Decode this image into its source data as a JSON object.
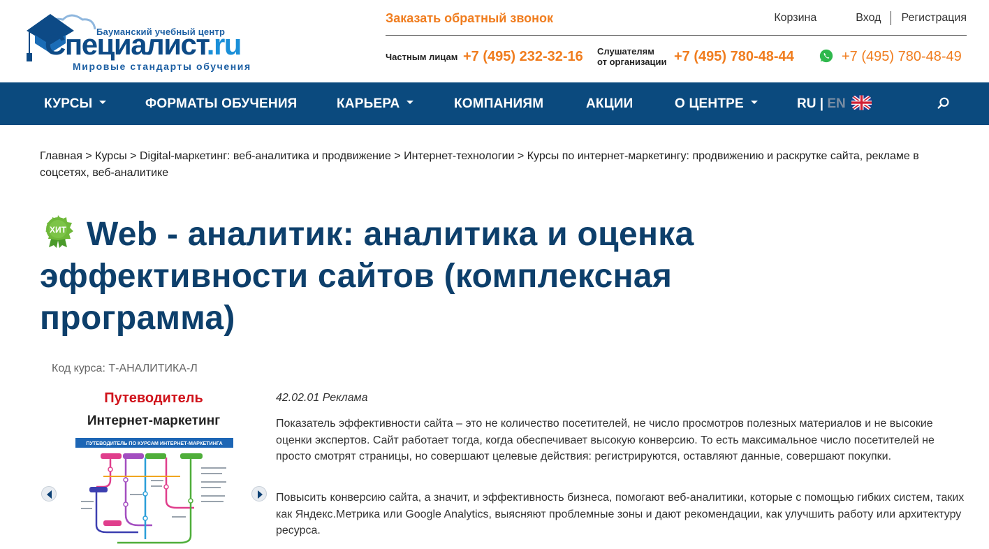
{
  "header": {
    "logo": {
      "subtitle": "Бауманский учебный центр",
      "name_main": "Специалист",
      "name_tld": ".ru",
      "tagline": "Мировые стандарты обучения"
    },
    "callback_label": "Заказать обратный звонок",
    "links": {
      "cart": "Корзина",
      "login": "Вход",
      "register": "Регистрация"
    },
    "phones": {
      "private_label": "Частным лицам",
      "private_number": "+7 (495) 232-32-16",
      "org_label_line1": "Слушателям",
      "org_label_line2": "от организации",
      "org_number": "+7 (495) 780-48-44",
      "whatsapp_number": "+7 (495) 780-48-49"
    },
    "colors": {
      "accent_orange": "#f07d1f",
      "nav_blue": "#0b4a7e",
      "title_blue": "#0d3f6b"
    }
  },
  "nav": {
    "items": [
      {
        "label": "КУРСЫ",
        "has_dropdown": true
      },
      {
        "label": "ФОРМАТЫ ОБУЧЕНИЯ",
        "has_dropdown": false
      },
      {
        "label": "КАРЬЕРА",
        "has_dropdown": true
      },
      {
        "label": "КОМПАНИЯМ",
        "has_dropdown": false
      },
      {
        "label": "АКЦИИ",
        "has_dropdown": false
      },
      {
        "label": "О ЦЕНТРЕ",
        "has_dropdown": true
      }
    ],
    "lang_ru": "RU",
    "lang_sep": " | ",
    "lang_en": "EN",
    "flag_icon": "uk-flag-icon",
    "search_icon": "search-icon"
  },
  "breadcrumb": {
    "items": [
      "Главная",
      "Курсы",
      "Digital-маркетинг: веб-аналитика и продвижение",
      "Интернет-технологии",
      "Курсы по интернет-маркетингу: продвижению и раскрутке сайта, рекламе в соцсетях, веб-аналитике"
    ],
    "separator": ">"
  },
  "page": {
    "badge_text": "ХИТ",
    "title": "Web - аналитик: аналитика и оценка эффективности сайтов (комплексная программа)",
    "course_code": "Код курса: Т-АНАЛИТИКА-Л"
  },
  "guide": {
    "title": "Путеводитель",
    "subtitle": "Интернет-маркетинг",
    "image_banner": "ПУТЕВОДИТЕЛЬ ПО КУРСАМ ИНТЕРНЕТ-МАРКЕТИНГА"
  },
  "content": {
    "code_line": "42.02.01 Реклама",
    "paragraph1": "Показатель эффективности сайта – это не количество посетителей, не число просмотров полезных материалов и не высокие оценки экспертов. Сайт работает тогда, когда обеспечивает высокую конверсию. То есть максимальное число посетителей не просто смотрят страницы, но совершают целевые действия: регистрируются, оставляют данные, совершают покупки.",
    "paragraph2": "Повысить конверсию сайта, а значит, и эффективность бизнеса, помогают веб-аналитики, которые с помощью гибких систем, таких как Яндекс.Метрика или Google Analytics, выясняют проблемные зоны и дают рекомендации, как улучшить работу или архитектуру ресурса."
  }
}
